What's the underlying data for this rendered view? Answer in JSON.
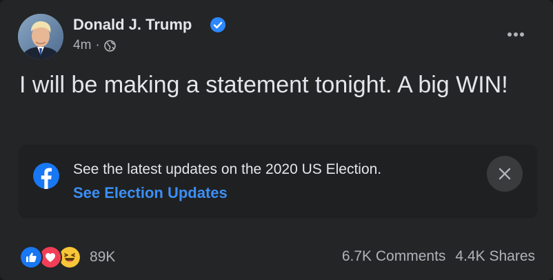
{
  "post": {
    "author": "Donald J. Trump",
    "verified": true,
    "time": "4m",
    "separator": "·",
    "privacy_icon": "globe-icon",
    "more_icon": "more-options-icon",
    "text": "I will be making a statement tonight. A big WIN!"
  },
  "info_box": {
    "icon": "facebook-logo-icon",
    "text": "See the latest updates on the 2020 US Election.",
    "link": "See Election Updates",
    "close_icon": "close-icon"
  },
  "engagement": {
    "reactions": [
      "like",
      "love",
      "haha"
    ],
    "reaction_count": "89K",
    "comments": "6.7K Comments",
    "shares": "4.4K Shares"
  },
  "colors": {
    "background": "#242526",
    "text_primary": "#e4e6eb",
    "text_secondary": "#b0b3b8",
    "link": "#3b8ff6",
    "verified": "#2d88ff"
  }
}
